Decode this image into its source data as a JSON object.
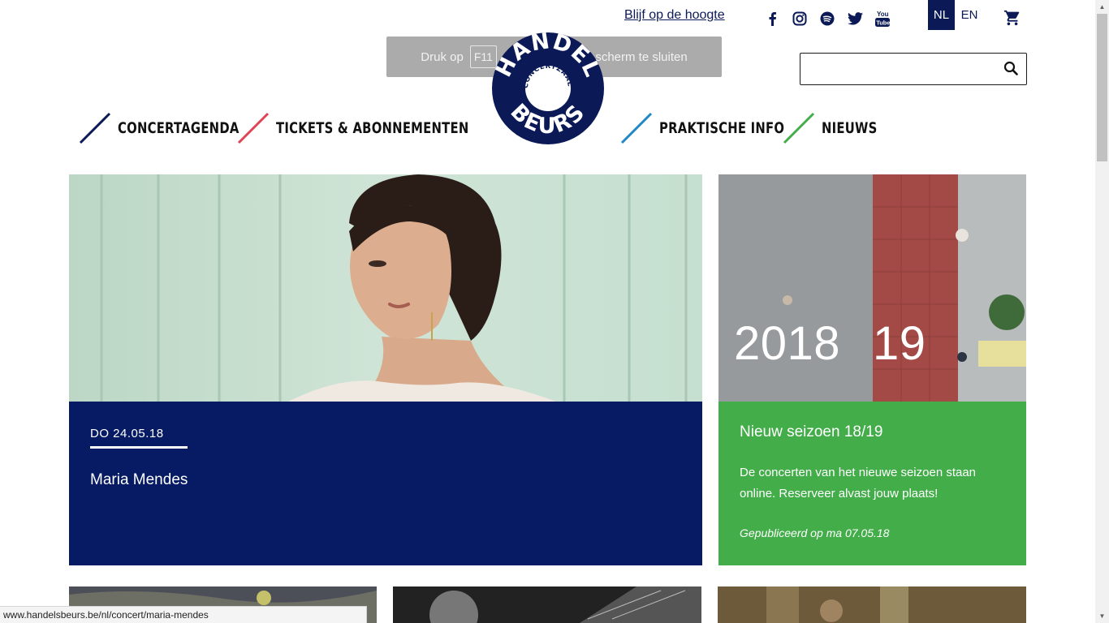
{
  "topbar": {
    "stay_updated": "Blijf op de hoogte",
    "social": [
      "facebook-icon",
      "instagram-icon",
      "spotify-icon",
      "twitter-icon",
      "youtube-icon"
    ],
    "lang_nl": "NL",
    "lang_en": "EN"
  },
  "toast": {
    "prefix": "Druk op",
    "key": "F11",
    "suffix": "om het volledige scherm te sluiten"
  },
  "logo": {
    "line1": "HANDEL",
    "line2": "BEURS",
    "inner": "CONCERTZAAL"
  },
  "search": {
    "placeholder": ""
  },
  "nav": [
    {
      "label": "CONCERTAGENDA",
      "color": "#0b1a56"
    },
    {
      "label": "TICKETS & ABONNEMENTEN",
      "color": "#e04454"
    },
    {
      "label": "PRAKTISCHE INFO",
      "color": "#1f86c8"
    },
    {
      "label": "NIEUWS",
      "color": "#43ad4a"
    }
  ],
  "featured": {
    "date": "DO  24.05.18",
    "title": "Maria Mendes",
    "panel_color": "#061b63"
  },
  "season": {
    "year_left": "2018",
    "year_right": "19",
    "title": "Nieuw seizoen 18/19",
    "text": "De concerten van het nieuwe seizoen staan online. Reserveer alvast jouw plaats!",
    "published": "Gepubliceerd op ma 07.05.18",
    "panel_color": "#43ad4a"
  },
  "statusbar": {
    "url": "www.handelsbeurs.be/nl/concert/maria-mendes"
  }
}
